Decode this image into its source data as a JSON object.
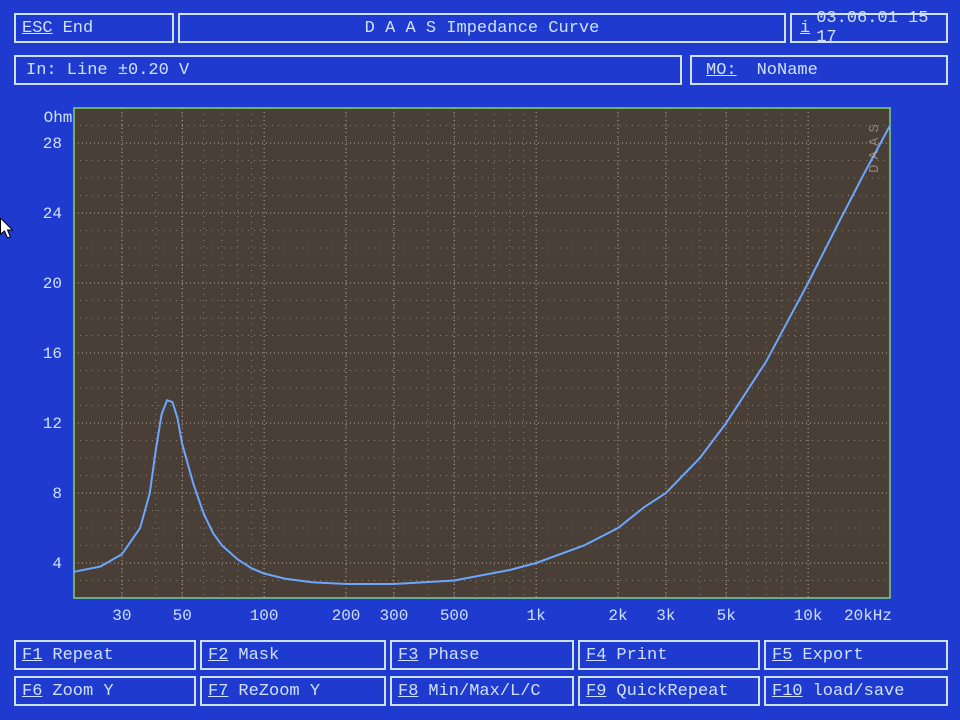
{
  "header": {
    "esc_key": "ESC",
    "esc_label": "End",
    "app_title": "D A A S   Impedance Curve",
    "info_icon": "i",
    "datetime": "03.06.01  15 17"
  },
  "status": {
    "input_line": "In: Line  ±0.20 V",
    "mo_key": "MO:",
    "mo_name": "NoName"
  },
  "fkeys": {
    "row1": [
      {
        "key": "F1",
        "label": "Repeat"
      },
      {
        "key": "F2",
        "label": "Mask"
      },
      {
        "key": "F3",
        "label": "Phase"
      },
      {
        "key": "F4",
        "label": "Print"
      },
      {
        "key": "F5",
        "label": "Export"
      }
    ],
    "row2": [
      {
        "key": "F6",
        "label": "Zoom Y"
      },
      {
        "key": "F7",
        "label": "ReZoom Y"
      },
      {
        "key": "F8",
        "label": "Min/Max/L/C"
      },
      {
        "key": "F9",
        "label": "QuickRepeat"
      },
      {
        "key": "F10",
        "label": "load/save"
      }
    ]
  },
  "chart_data": {
    "type": "line",
    "title": "",
    "ylabel": "Ohm",
    "x_unit": "kHz",
    "x_scale": "log",
    "x_ticks": [
      30,
      50,
      100,
      200,
      300,
      500,
      1000,
      2000,
      3000,
      5000,
      10000,
      20000
    ],
    "x_tick_labels": [
      "30",
      "50",
      "100",
      "200",
      "300",
      "500",
      "1k",
      "2k",
      "3k",
      "5k",
      "10k",
      "20kHz"
    ],
    "xlim": [
      20,
      20000
    ],
    "y_ticks": [
      4,
      8,
      12,
      16,
      20,
      24,
      28
    ],
    "ylim": [
      2,
      30
    ],
    "grid": true,
    "watermark": "DAAS",
    "colors": {
      "line": "#6aa7ff",
      "plot_bg": "#4a3f37",
      "grid": "#bdb2a6",
      "axis_edge": "#88e070"
    },
    "series": [
      {
        "name": "Impedance",
        "x": [
          20,
          25,
          30,
          35,
          38,
          40,
          42,
          44,
          46,
          48,
          50,
          55,
          60,
          65,
          70,
          80,
          90,
          100,
          120,
          150,
          200,
          300,
          500,
          800,
          1000,
          1500,
          2000,
          2500,
          3000,
          4000,
          5000,
          7000,
          10000,
          13000,
          16000,
          20000
        ],
        "y": [
          3.5,
          3.8,
          4.5,
          6.0,
          8.0,
          10.5,
          12.5,
          13.3,
          13.2,
          12.3,
          10.8,
          8.5,
          6.8,
          5.7,
          5.0,
          4.2,
          3.7,
          3.4,
          3.1,
          2.9,
          2.8,
          2.8,
          3.0,
          3.6,
          4.0,
          5.0,
          6.0,
          7.2,
          8.0,
          10.0,
          12.0,
          15.5,
          20.0,
          23.5,
          26.2,
          29.0
        ]
      }
    ]
  }
}
